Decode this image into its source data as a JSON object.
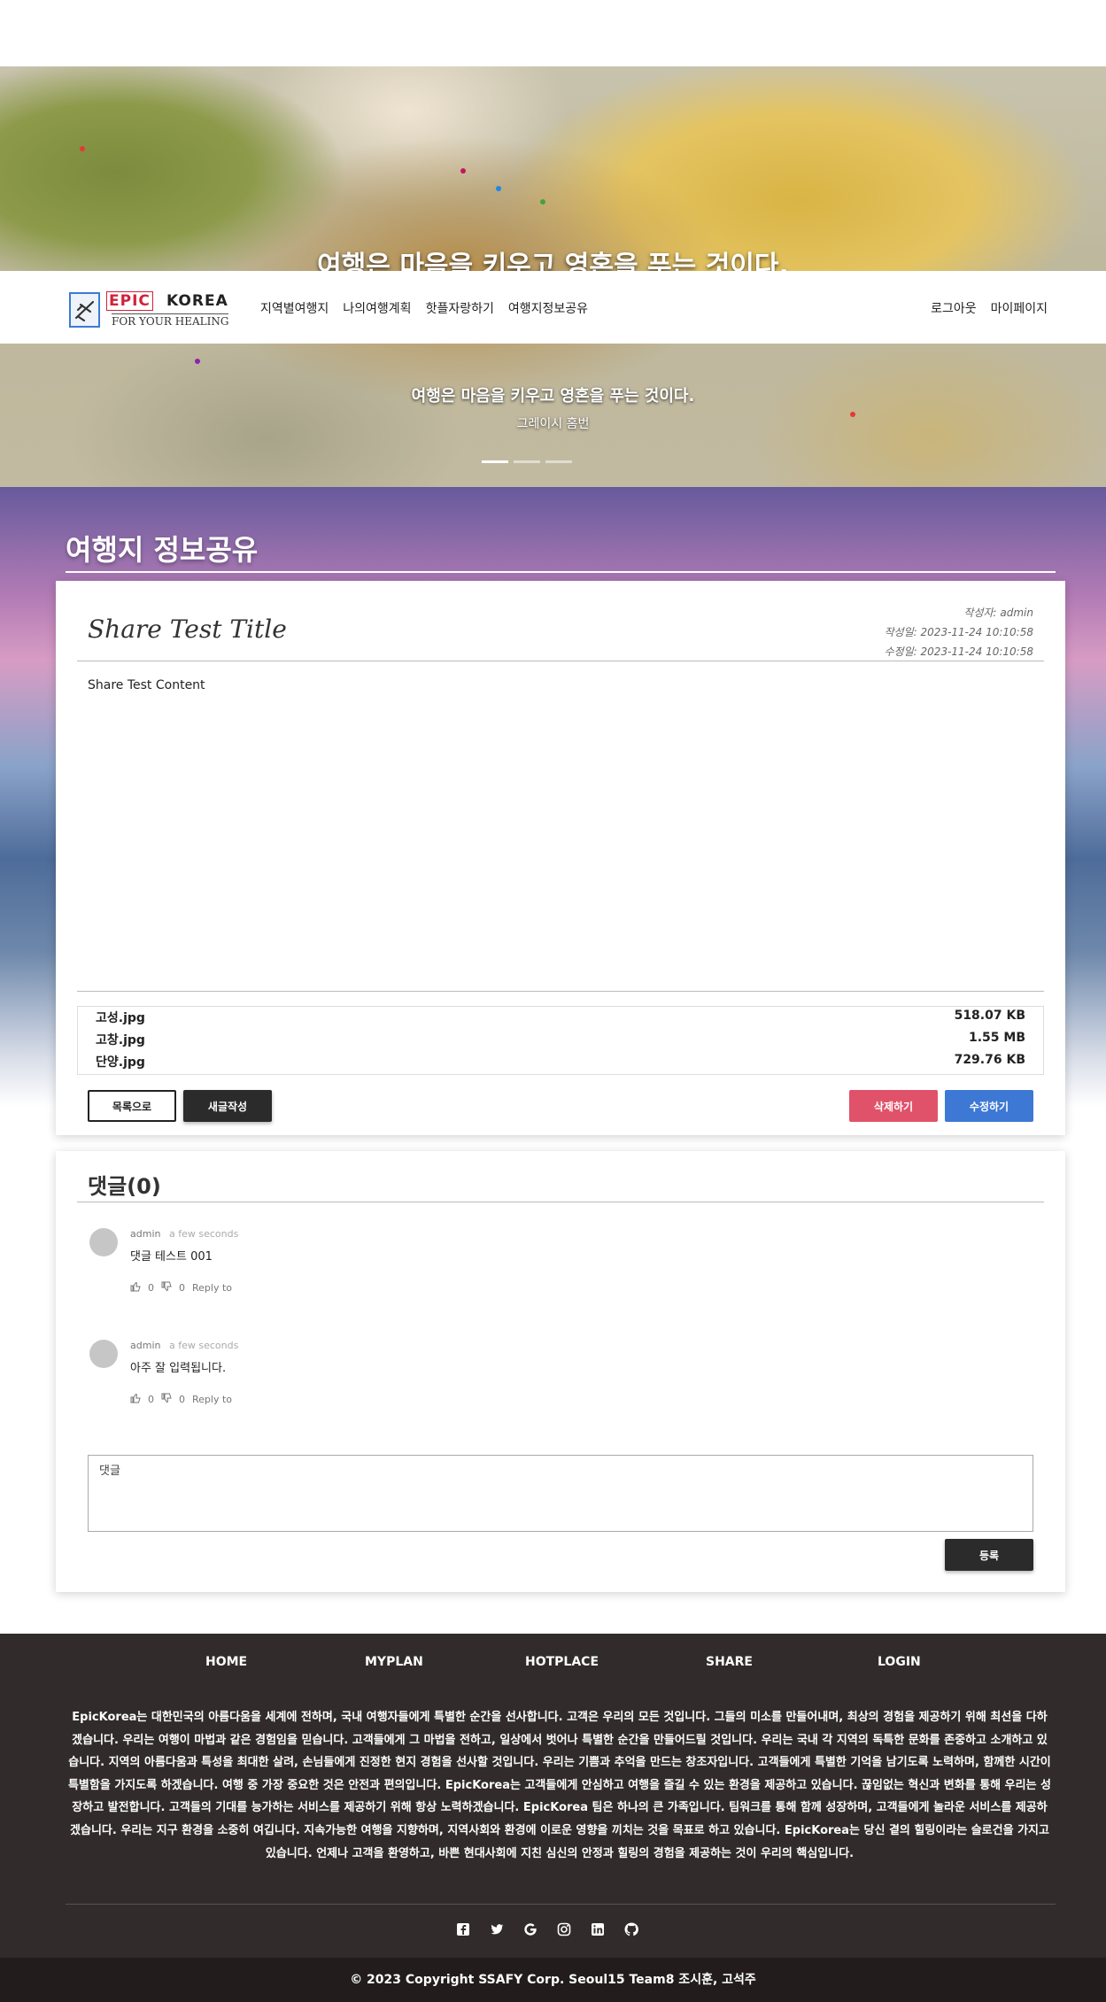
{
  "hero": {
    "quote_top": "여행은 마음을 키우고 영혼을 푸는 것이다.",
    "quote": "여행은 마음을 키우고 영혼을 푸는 것이다.",
    "author": "그레이시 홈번"
  },
  "navbar": {
    "logo_epic": "EPIC",
    "logo_korea": "KOREA",
    "logo_sub": "FOR YOUR HEALING",
    "links": [
      "지역별여행지",
      "나의여행계획",
      "핫플자랑하기",
      "여행지정보공유"
    ],
    "logout": "로그아웃",
    "mypage": "마이페이지"
  },
  "page": {
    "title": "여행지 정보공유"
  },
  "article": {
    "title": "Share Test Title",
    "author": "작성자: admin",
    "created": "작성일: 2023-11-24 10:10:58",
    "modified": "수정일: 2023-11-24 10:10:58",
    "content": "Share Test Content",
    "files": [
      {
        "name": "고성.jpg",
        "size": "518.07 KB"
      },
      {
        "name": "고창.jpg",
        "size": "1.55 MB"
      },
      {
        "name": "단양.jpg",
        "size": "729.76 KB"
      }
    ],
    "btn_list": "목록으로",
    "btn_new": "새글작성",
    "btn_delete": "삭제하기",
    "btn_edit": "수정하기"
  },
  "comments": {
    "title": "댓글(0)",
    "items": [
      {
        "author": "admin",
        "time": "a few seconds",
        "text": "댓글 테스트 001",
        "likes": "0",
        "dislikes": "0",
        "reply": "Reply to"
      },
      {
        "author": "admin",
        "time": "a few seconds",
        "text": "아주 잘 입력됩니다.",
        "likes": "0",
        "dislikes": "0",
        "reply": "Reply to"
      }
    ],
    "placeholder": "댓글",
    "btn_register": "등록"
  },
  "footer": {
    "nav": [
      "HOME",
      "MYPLAN",
      "HOTPLACE",
      "SHARE",
      "LOGIN"
    ],
    "description": "EpicKorea는 대한민국의 아름다움을 세계에 전하며, 국내 여행자들에게 특별한 순간을 선사합니다. 고객은 우리의 모든 것입니다. 그들의 미소를 만들어내며, 최상의 경험을 제공하기 위해 최선을 다하겠습니다. 우리는 여행이 마법과 같은 경험임을 믿습니다. 고객들에게 그 마법을 전하고, 일상에서 벗어나 특별한 순간을 만들어드릴 것입니다. 우리는 국내 각 지역의 독특한 문화를 존중하고 소개하고 있습니다. 지역의 아름다움과 특성을 최대한 살려, 손님들에게 진정한 현지 경험을 선사할 것입니다. 우리는 기쁨과 추억을 만드는 창조자입니다. 고객들에게 특별한 기억을 남기도록 노력하며, 함께한 시간이 특별함을 가지도록 하겠습니다. 여행 중 가장 중요한 것은 안전과 편의입니다. EpicKorea는 고객들에게 안심하고 여행을 즐길 수 있는 환경을 제공하고 있습니다. 끊임없는 혁신과 변화를 통해 우리는 성장하고 발전합니다. 고객들의 기대를 능가하는 서비스를 제공하기 위해 항상 노력하겠습니다. EpicKorea 팀은 하나의 큰 가족입니다. 팀워크를 통해 함께 성장하며, 고객들에게 놀라운 서비스를 제공하겠습니다. 우리는 지구 환경을 소중히 여깁니다. 지속가능한 여행을 지향하며, 지역사회와 환경에 이로운 영향을 끼치는 것을 목표로 하고 있습니다. EpicKorea는 당신 곁의 힐링이라는 슬로건을 가지고 있습니다. 언제나 고객을 환영하고, 바쁜 현대사회에 지친 심신의 안정과 힐링의 경험을 제공하는 것이 우리의 핵심입니다.",
    "socials": [
      "facebook-icon",
      "twitter-icon",
      "google-icon",
      "instagram-icon",
      "linkedin-icon",
      "github-icon"
    ],
    "copyright": "© 2023 Copyright SSAFY Corp. Seoul15 Team8 조시훈, 고석주"
  },
  "colors": {
    "accent_blue": "#3d78d5",
    "danger_red": "#e0526a",
    "footer_bg": "#312b2b"
  }
}
